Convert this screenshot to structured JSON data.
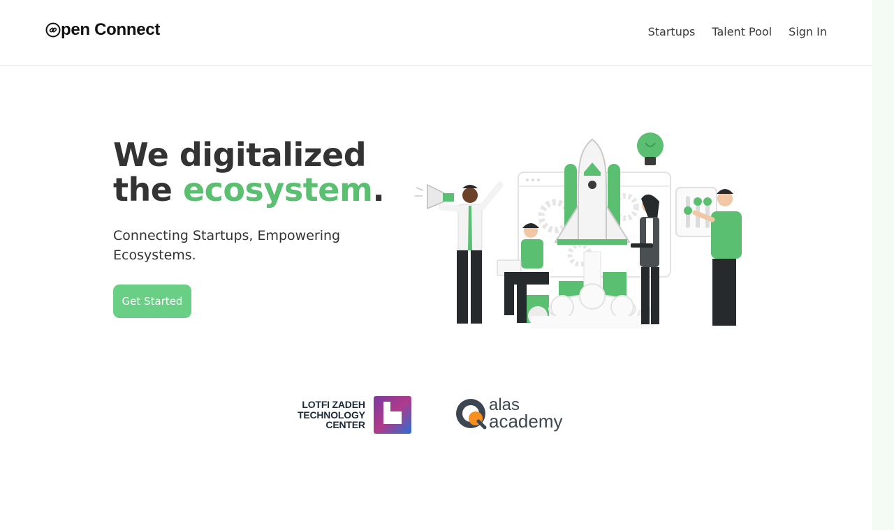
{
  "brand": {
    "name": "pen Connect",
    "icon": "link-o-icon"
  },
  "nav": {
    "items": [
      {
        "label": "Startups"
      },
      {
        "label": "Talent Pool"
      },
      {
        "label": "Sign In"
      }
    ]
  },
  "hero": {
    "title_line1": "We digitalized",
    "title_the": "the ",
    "title_accent": "ecosystem",
    "title_period": ".",
    "subtitle": "Connecting Startups, Empowering Ecosystems.",
    "cta_label": "Get Started",
    "illustration": "startup-rocket-team-illustration"
  },
  "partners": {
    "lotfi": {
      "line1": "LOTFI ZADEH",
      "line2": "TECHNOLOGY",
      "line3": "CENTER"
    },
    "alas": {
      "line1": "alas",
      "line2": "academy"
    }
  },
  "colors": {
    "accent": "#5abf71",
    "button": "#69cf84",
    "text": "#333333",
    "border": "#e6e6e6"
  }
}
